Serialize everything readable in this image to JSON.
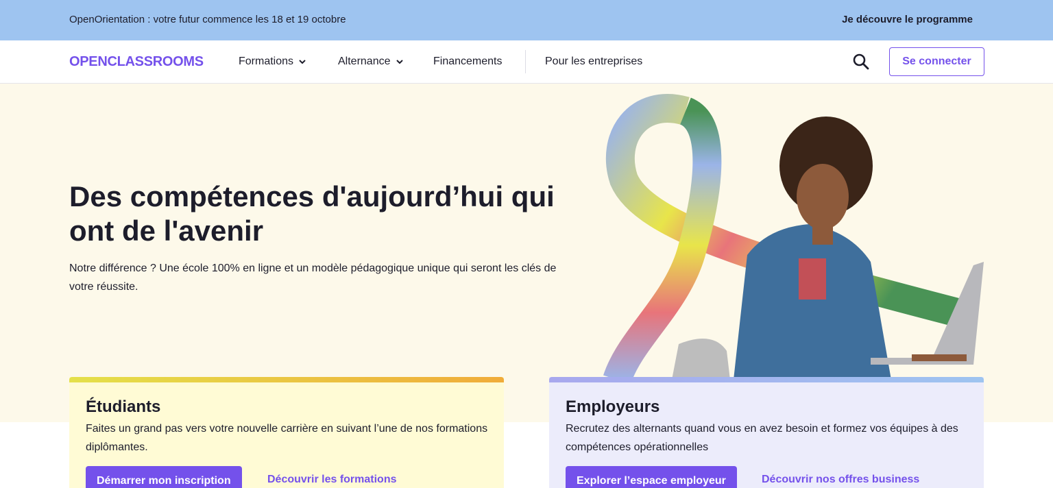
{
  "banner": {
    "text": "OpenOrientation : votre futur commence les 18 et 19 octobre",
    "link": "Je découvre le programme"
  },
  "nav": {
    "logo": "OPENCLASSROOMS",
    "items": [
      {
        "label": "Formations",
        "has_dropdown": true
      },
      {
        "label": "Alternance",
        "has_dropdown": true
      },
      {
        "label": "Financements",
        "has_dropdown": false
      },
      {
        "label": "Pour les entreprises",
        "has_dropdown": false
      }
    ],
    "search_icon": "search-icon",
    "login": "Se connecter"
  },
  "hero": {
    "title": "Des compétences d'aujourd’hui qui ont de l'avenir",
    "subtitle": "Notre différence ? Une école 100% en ligne et un modèle pédagogique unique qui seront les clés de votre réussite."
  },
  "cards": {
    "students": {
      "title": "Étudiants",
      "text": "Faites un grand pas vers votre nouvelle carrière en suivant l’une de nos formations diplômantes.",
      "primary": "Démarrer mon inscription",
      "secondary": "Découvrir les formations"
    },
    "employers": {
      "title": "Employeurs",
      "text": "Recrutez des alternants quand vous en avez besoin et formez vos équipes à des compétences opérationnelles",
      "primary": "Explorer l’espace employeur",
      "secondary": "Découvrir nos offres business"
    }
  },
  "colors": {
    "brand": "#7451eb",
    "banner": "#9ec4f0",
    "hero_bg": "#fdf9ea",
    "students_card": "#fffbd5",
    "employers_card": "#ececfb"
  }
}
